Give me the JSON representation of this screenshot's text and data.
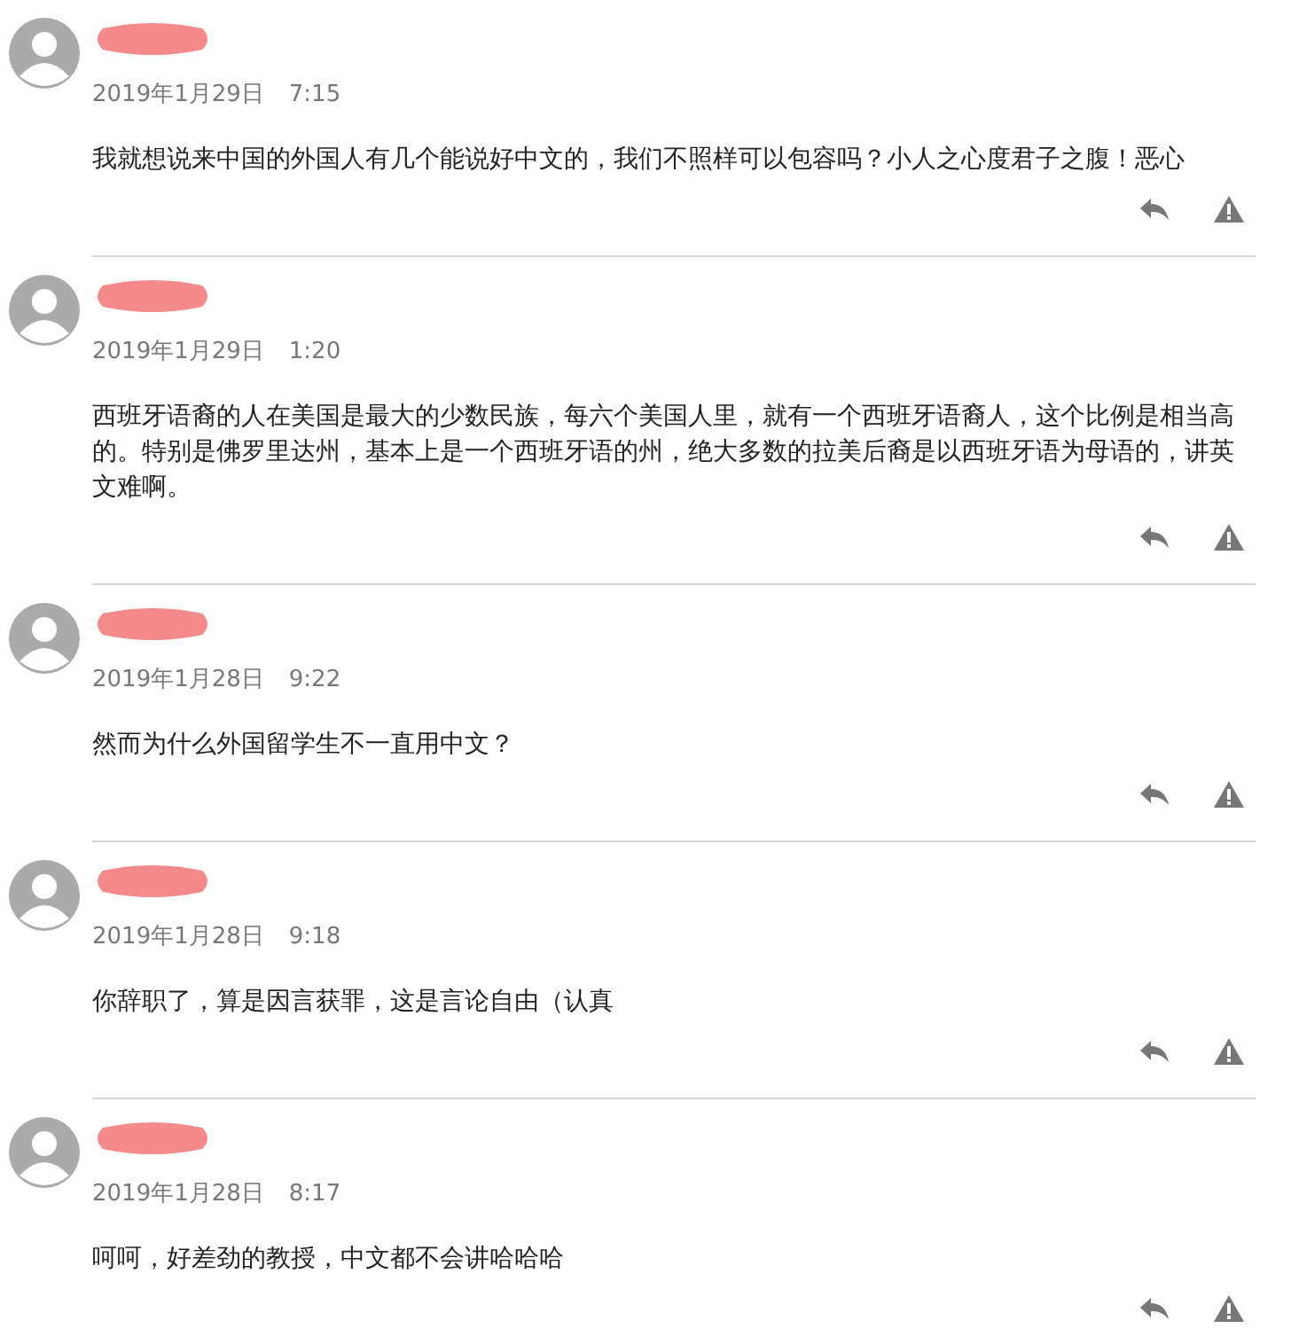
{
  "comments": [
    {
      "date": "2019年1月29日",
      "time": "7:15",
      "text": "我就想说来中国的外国人有几个能说好中文的，我们不照样可以包容吗？小人之心度君子之腹！恶心"
    },
    {
      "date": "2019年1月29日",
      "time": "1:20",
      "text": "西班牙语裔的人在美国是最大的少数民族，每六个美国人里，就有一个西班牙语裔人，这个比例是相当高的。特别是佛罗里达州，基本上是一个西班牙语的州，绝大多数的拉美后裔是以西班牙语为母语的，讲英文难啊。"
    },
    {
      "date": "2019年1月28日",
      "time": "9:22",
      "text": "然而为什么外国留学生不一直用中文？"
    },
    {
      "date": "2019年1月28日",
      "time": "9:18",
      "text": "你辞职了，算是因言获罪，这是言论自由（认真"
    },
    {
      "date": "2019年1月28日",
      "time": "8:17",
      "text": "呵呵，好差劲的教授，中文都不会讲哈哈哈"
    }
  ]
}
